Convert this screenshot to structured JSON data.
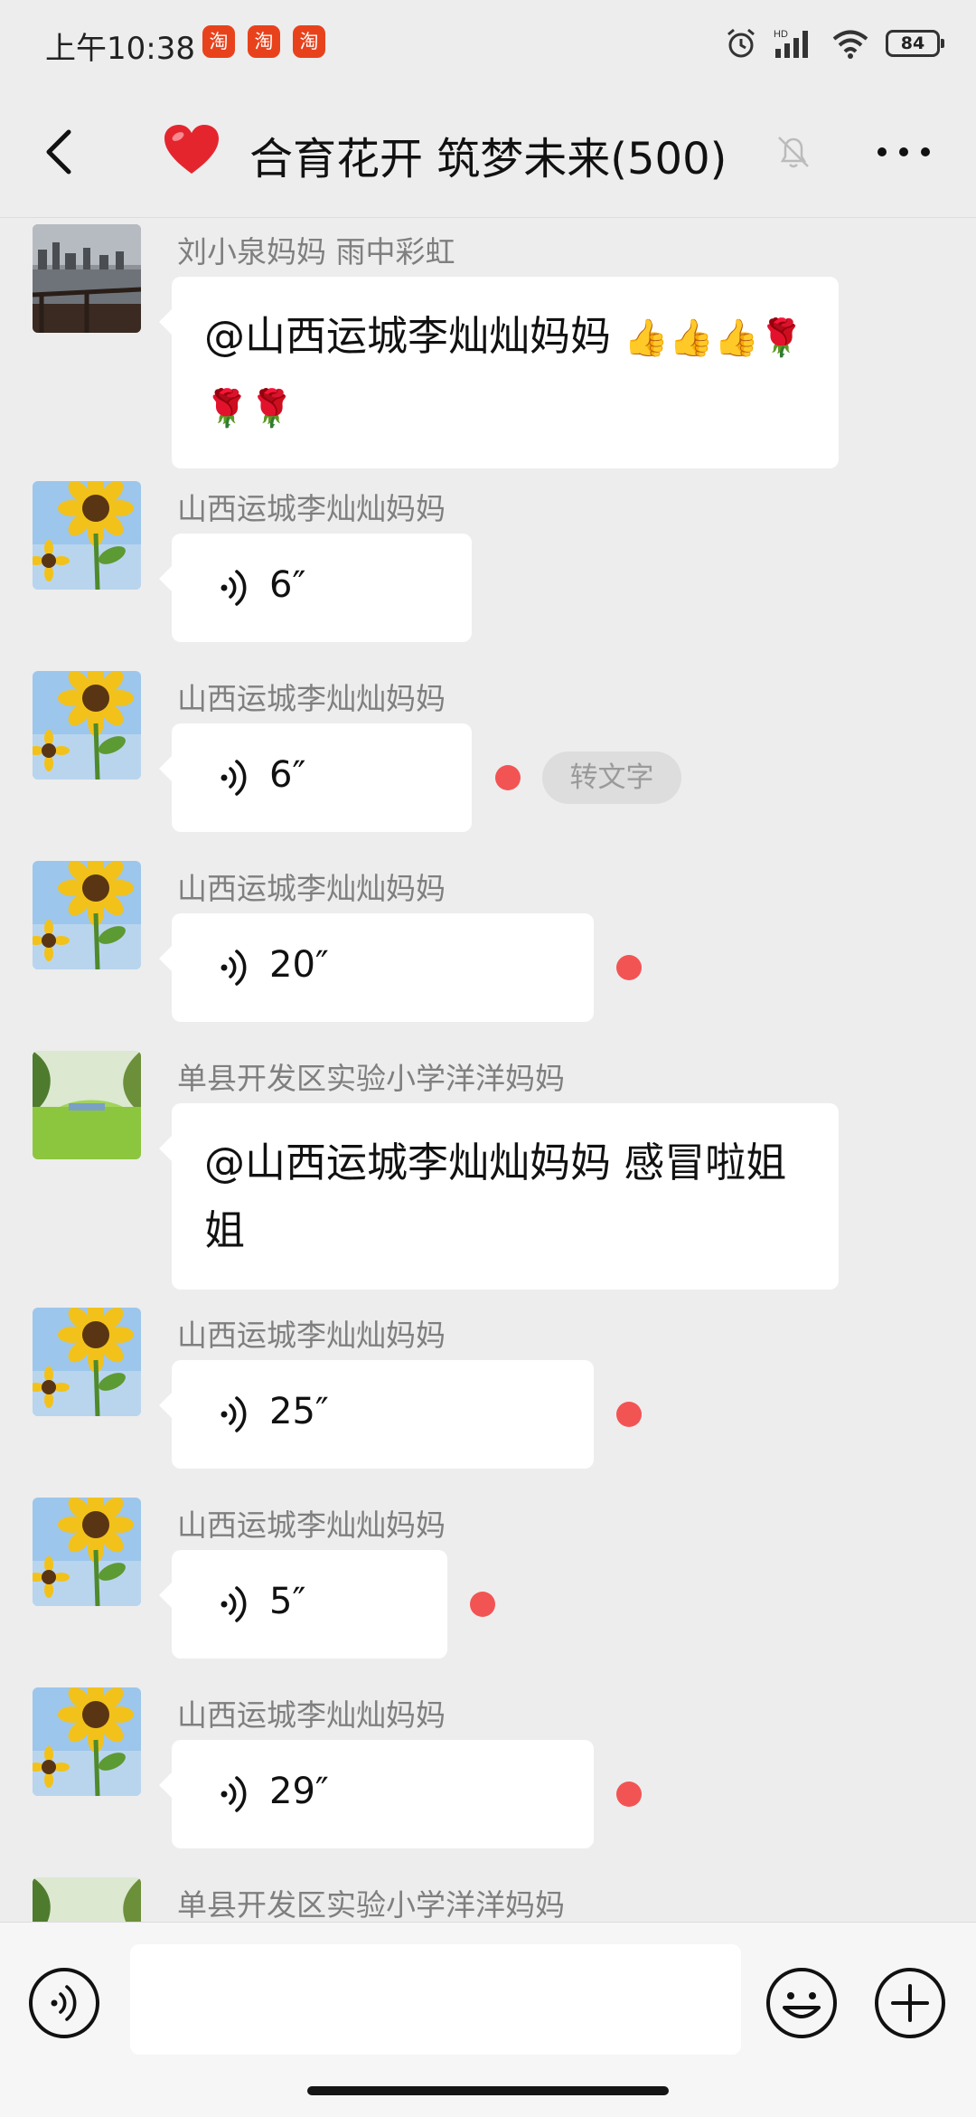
{
  "status_bar": {
    "time": "上午10:38",
    "taobao_icon_label": "淘",
    "battery": "84"
  },
  "header": {
    "title": "合育花开 筑梦未来(500)"
  },
  "messages": [
    {
      "sender": "刘小泉妈妈  雨中彩虹",
      "text": "@山西运城李灿灿妈妈",
      "emojis": "👍👍👍🌹🌹🌹"
    },
    {
      "sender": "山西运城李灿灿妈妈",
      "duration": "6″"
    },
    {
      "sender": "山西运城李灿灿妈妈",
      "duration": "6″",
      "to_text": "转文字"
    },
    {
      "sender": "山西运城李灿灿妈妈",
      "duration": "20″"
    },
    {
      "sender": "单县开发区实验小学洋洋妈妈",
      "text": "@山西运城李灿灿妈妈  感冒啦姐姐"
    },
    {
      "sender": "山西运城李灿灿妈妈",
      "duration": "25″"
    },
    {
      "sender": "山西运城李灿灿妈妈",
      "duration": "5″"
    },
    {
      "sender": "山西运城李灿灿妈妈",
      "duration": "29″"
    },
    {
      "sender": "单县开发区实验小学洋洋妈妈"
    }
  ],
  "input": {
    "value": ""
  }
}
